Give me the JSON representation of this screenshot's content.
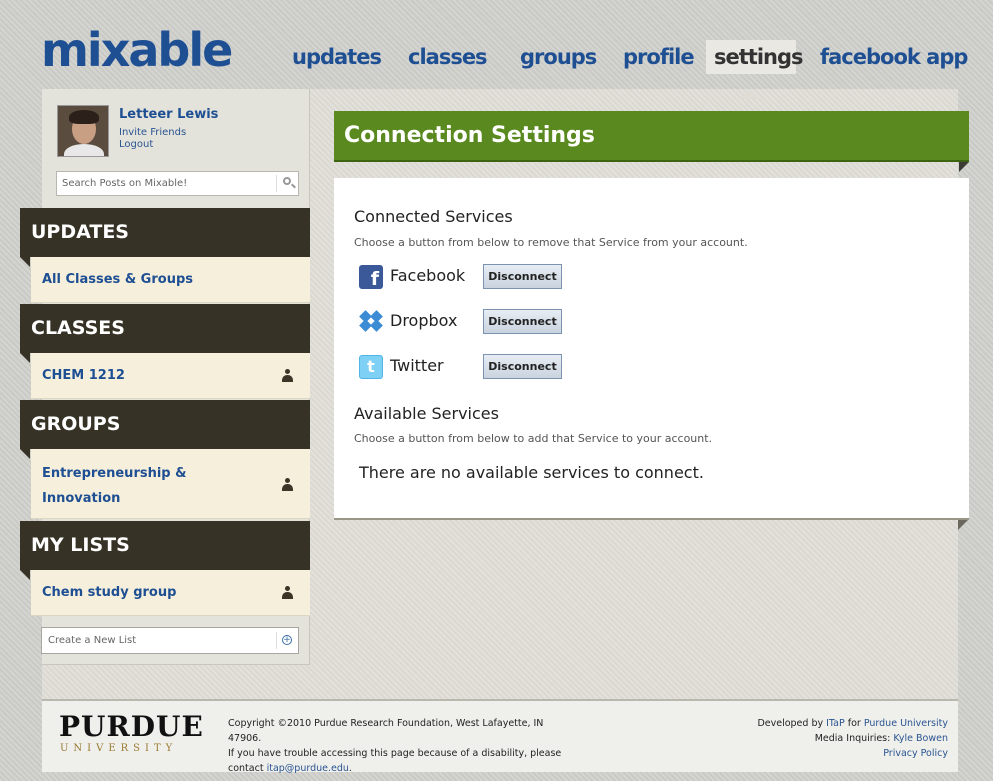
{
  "brand": {
    "logo_text": "mixable"
  },
  "nav": {
    "items": [
      {
        "label": "updates"
      },
      {
        "label": "classes"
      },
      {
        "label": "groups"
      },
      {
        "label": "profile"
      },
      {
        "label": "settings",
        "active": true
      },
      {
        "label": "facebook app"
      }
    ]
  },
  "user": {
    "name": "Letteer Lewis",
    "invite_label": "Invite Friends",
    "logout_label": "Logout"
  },
  "search": {
    "placeholder": "Search Posts on Mixable!"
  },
  "sidebar": {
    "updates": {
      "heading": "UPDATES",
      "items": [
        {
          "label": "All Classes & Groups"
        }
      ]
    },
    "classes": {
      "heading": "CLASSES",
      "items": [
        {
          "label": "CHEM 1212"
        }
      ]
    },
    "groups": {
      "heading": "GROUPS",
      "items": [
        {
          "label": "Entrepreneurship &"
        },
        {
          "label": "Innovation"
        }
      ]
    },
    "lists": {
      "heading": "MY LISTS",
      "items": [
        {
          "label": "Chem study group"
        }
      ]
    },
    "new_list_placeholder": "Create a New List"
  },
  "main": {
    "title": "Connection Settings",
    "connected_heading": "Connected Services",
    "connected_sub": "Choose a button from below to remove that Service from your account.",
    "services": [
      {
        "name": "Facebook",
        "icon": "facebook-icon",
        "button": "Disconnect"
      },
      {
        "name": "Dropbox",
        "icon": "dropbox-icon",
        "button": "Disconnect"
      },
      {
        "name": "Twitter",
        "icon": "twitter-icon",
        "button": "Disconnect"
      }
    ],
    "available_heading": "Available Services",
    "available_sub": "Choose a button from below to add that Service to your account.",
    "no_services": "There are no available services to connect."
  },
  "footer": {
    "purdue_main": "PURDUE",
    "purdue_sub": "UNIVERSITY",
    "copy_line1": "Copyright ©2010 Purdue Research Foundation, West Lafayette, IN 47906.",
    "copy_line2": "If you have trouble accessing this page because of a disability, please",
    "copy_line3_pre": "contact ",
    "copy_email": "itap@purdue.edu",
    "copy_line3_post": ".",
    "dev_pre": "Developed by ",
    "dev_itap": "ITaP",
    "dev_mid": " for ",
    "dev_purdue": "Purdue University",
    "media_pre": "Media Inquiries: ",
    "media_name": "Kyle Bowen",
    "privacy": "Privacy Policy"
  },
  "colors": {
    "brand_blue": "#1f4f93",
    "green_bar": "#5a8a1f",
    "sidebar_dark": "#373226",
    "sidebar_item_bg": "#f5efdc"
  }
}
